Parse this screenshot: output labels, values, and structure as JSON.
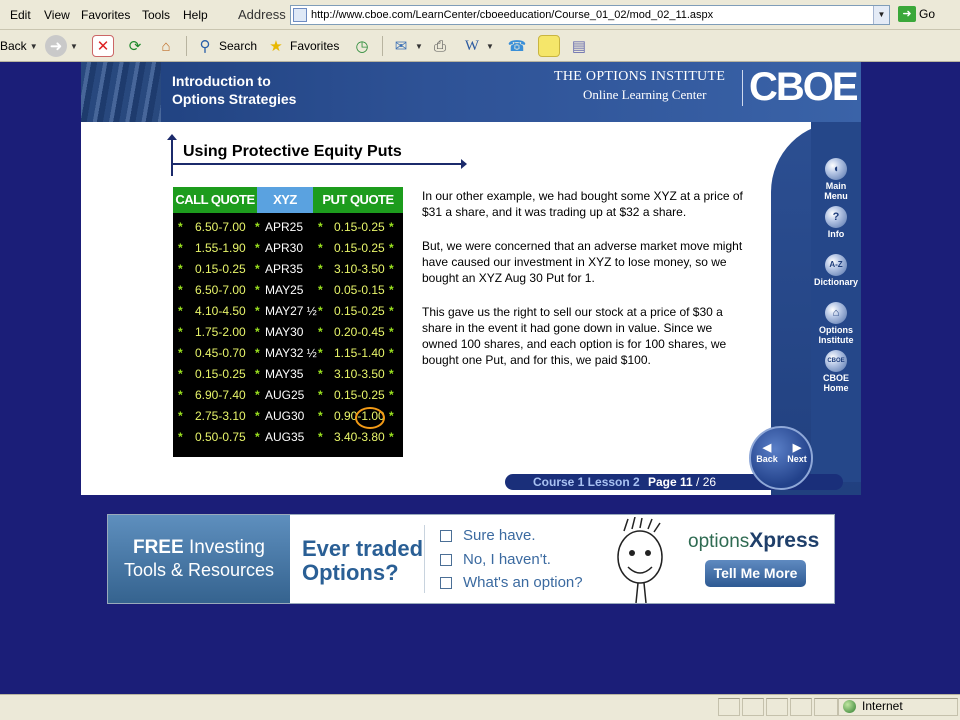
{
  "menubar": {
    "items": [
      "Edit",
      "View",
      "Favorites",
      "Tools",
      "Help"
    ],
    "address_label": "Address",
    "url": "http://www.cboe.com/LearnCenter/cboeeducation/Course_01_02/mod_02_11.aspx",
    "go_label": "Go"
  },
  "toolbar": {
    "back_label": "Back",
    "search_label": "Search",
    "favorites_label": "Favorites"
  },
  "header": {
    "title_line1": "Introduction to",
    "title_line2": "Options Strategies",
    "institute_line1": "THE OPTIONS INSTITUTE",
    "institute_line2": "Online Learning Center",
    "logo": "CBOE"
  },
  "nav": {
    "items": [
      {
        "glyph": "◖",
        "label1": "Main",
        "label2": "Menu"
      },
      {
        "glyph": "?",
        "label1": "Info",
        "label2": ""
      },
      {
        "glyph": "A-Z",
        "label1": "Dictionary",
        "label2": ""
      },
      {
        "glyph": "⌂",
        "label1": "Options",
        "label2": "Institute"
      },
      {
        "glyph": "CBOE",
        "label1": "CBOE",
        "label2": "Home"
      }
    ],
    "back_label": "Back",
    "next_label": "Next"
  },
  "pagebar": {
    "course": "Course 1 Lesson 2",
    "page_label": "Page",
    "page_current": "11",
    "page_total": " / 26"
  },
  "lesson": {
    "title": "Using Protective Equity Puts",
    "paragraphs": [
      "In our other example, we had bought some XYZ at a price of $31 a share, and it was trading up at $32 a share.",
      "But, we were concerned that an adverse market move might have caused our investment in XYZ to lose money, so we bought an XYZ Aug 30 Put for 1.",
      "This gave us the right to sell our stock at a price of $30 a share in the event it had gone down in value. Since we owned 100 shares, and each option is for 100 shares, we bought one Put, and for this, we paid $100."
    ]
  },
  "quote_table": {
    "headers": [
      "CALL QUOTE",
      "XYZ",
      "PUT QUOTE"
    ],
    "header_colors": [
      "#1d9c1d",
      "#5aa2e0",
      "#1d9c1d"
    ],
    "star": "*",
    "rows": [
      {
        "call": "6.50-7.00",
        "sym": "APR25",
        "put": "0.15-0.25"
      },
      {
        "call": "1.55-1.90",
        "sym": "APR30",
        "put": "0.15-0.25"
      },
      {
        "call": "0.15-0.25",
        "sym": "APR35",
        "put": "3.10-3.50"
      },
      {
        "call": "6.50-7.00",
        "sym": "MAY25",
        "put": "0.05-0.15"
      },
      {
        "call": "4.10-4.50",
        "sym": "MAY27 ½",
        "put": "0.15-0.25"
      },
      {
        "call": "1.75-2.00",
        "sym": "MAY30",
        "put": "0.20-0.45"
      },
      {
        "call": "0.45-0.70",
        "sym": "MAY32 ½",
        "put": "1.15-1.40"
      },
      {
        "call": "0.15-0.25",
        "sym": "MAY35",
        "put": "3.10-3.50"
      },
      {
        "call": "6.90-7.40",
        "sym": "AUG25",
        "put": "0.15-0.25"
      },
      {
        "call": "2.75-3.10",
        "sym": "AUG30",
        "put": "0.90-1.00"
      },
      {
        "call": "0.50-0.75",
        "sym": "AUG35",
        "put": "3.40-3.80"
      }
    ],
    "highlight_color": "#f29a16"
  },
  "ad": {
    "left_line1_bold": "FREE",
    "left_line1_rest": " Investing",
    "left_line2": "Tools & Resources",
    "question_line1": "Ever traded",
    "question_line2": "Options?",
    "options": [
      "Sure have.",
      "No, I haven't.",
      "What's an option?"
    ],
    "brand_prefix": "options",
    "brand_suffix": "Xpress",
    "button": "Tell Me More"
  },
  "status": {
    "zone": "Internet"
  }
}
